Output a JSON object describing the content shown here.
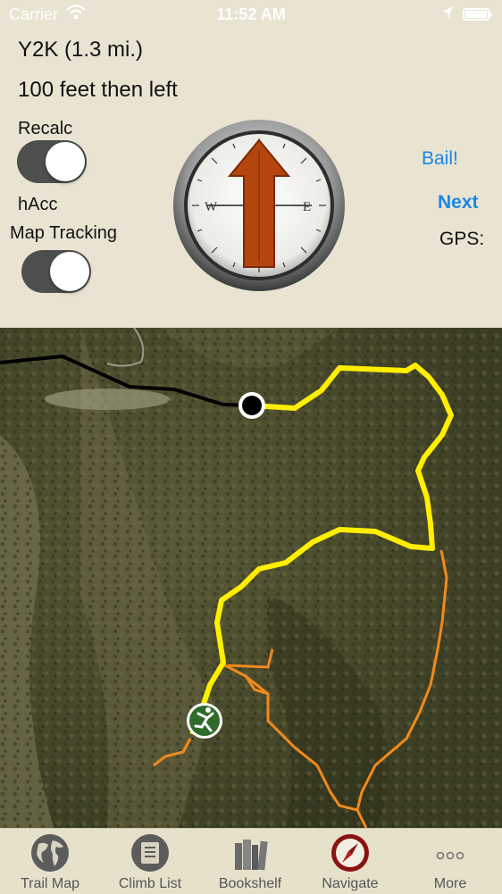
{
  "status_bar": {
    "carrier": "Carrier",
    "time": "11:52 AM"
  },
  "navigate": {
    "route_title": "Y2K (1.3 mi.)",
    "direction": "100 feet then left",
    "recalc_label": "Recalc",
    "recalc_on": true,
    "hacc_label": "hAcc",
    "map_tracking_label": "Map Tracking",
    "map_tracking_on": true,
    "bail_label": "Bail!",
    "next_label": "Next",
    "gps_label": "GPS:"
  },
  "compass": {
    "west": "W",
    "east": "E"
  },
  "map": {
    "colors": {
      "route": "#ffee00",
      "trail": "#f08a1c",
      "road": "#000000"
    }
  },
  "tabs": [
    {
      "label": "Trail Map",
      "icon": "globe-icon"
    },
    {
      "label": "Climb List",
      "icon": "list-icon"
    },
    {
      "label": "Bookshelf",
      "icon": "books-icon"
    },
    {
      "label": "Navigate",
      "icon": "compass-icon",
      "active": true
    },
    {
      "label": "More",
      "icon": "more-icon"
    }
  ]
}
